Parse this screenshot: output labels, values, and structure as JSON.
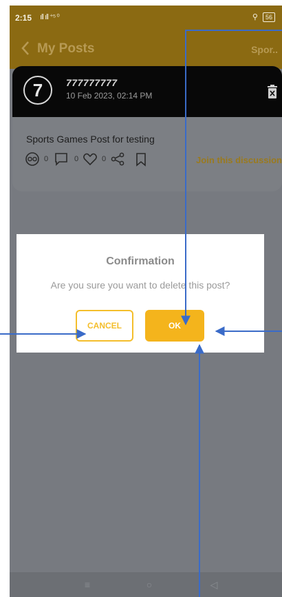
{
  "status": {
    "time": "2:15",
    "signal": "ıll ıll ⁺⁵ ⁰",
    "net": "⚲",
    "battery": "56"
  },
  "appbar": {
    "title": "My Posts",
    "right_label": "Spor.."
  },
  "post": {
    "badge": "7",
    "username": "777777777",
    "date": "10 Feb 2023, 02:14 PM",
    "text": "Sports Games Post for testing",
    "counts": [
      "0",
      "0",
      "0"
    ],
    "join_label": "Join this discussion"
  },
  "dialog": {
    "title": "Confirmation",
    "message": "Are you sure you want to delete this post?",
    "cancel_label": "CANCEL",
    "ok_label": "OK"
  },
  "icons": [
    "back-icon",
    "trash-icon",
    "eyes-icon",
    "comment-icon",
    "heart-icon",
    "share-icon",
    "bookmark-icon",
    "nav-menu-icon",
    "nav-home-icon",
    "nav-back-icon"
  ],
  "colors": {
    "accent": "#f4b41c",
    "appbar": "#8b6a12",
    "annotation": "#3a6bc8"
  }
}
